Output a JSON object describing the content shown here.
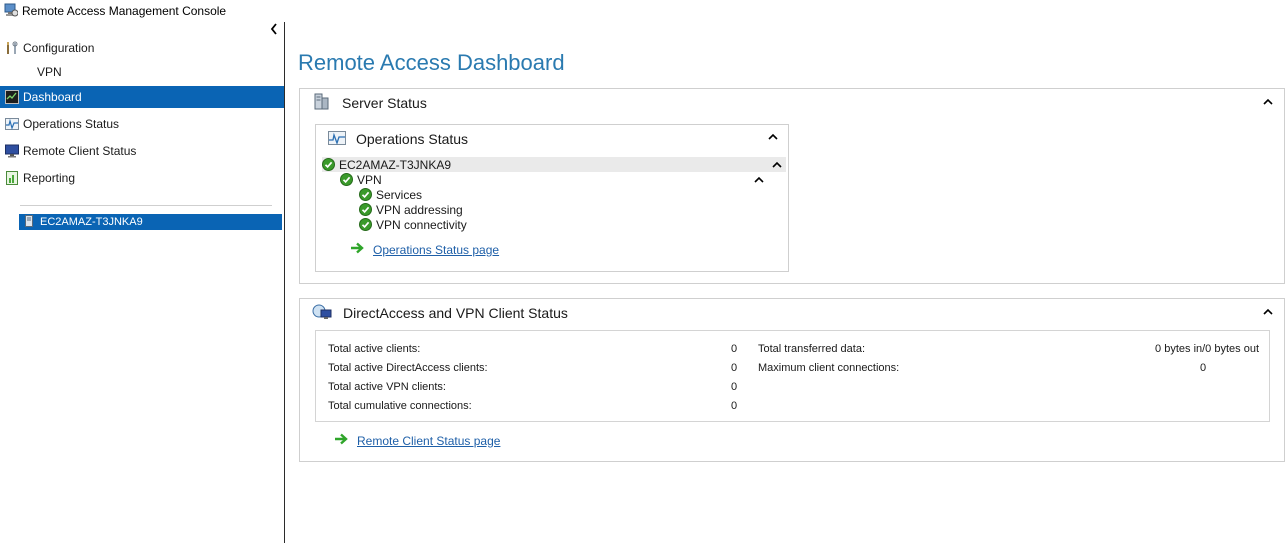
{
  "window": {
    "title": "Remote Access Management Console"
  },
  "nav": {
    "configuration": "Configuration",
    "vpn": "VPN",
    "dashboard": "Dashboard",
    "operations_status": "Operations Status",
    "remote_client_status": "Remote Client Status",
    "reporting": "Reporting",
    "server": "EC2AMAZ-T3JNKA9"
  },
  "main": {
    "title": "Remote Access Dashboard",
    "server_status": {
      "title": "Server Status",
      "operations": {
        "title": "Operations Status",
        "server": "EC2AMAZ-T3JNKA9",
        "vpn": "VPN",
        "services": "Services",
        "vpn_addressing": "VPN addressing",
        "vpn_connectivity": "VPN connectivity",
        "link": "Operations Status page"
      }
    },
    "client_status": {
      "title": "DirectAccess and VPN Client Status",
      "left_labels": [
        "Total active clients:",
        "Total active DirectAccess clients:",
        "Total active VPN clients:",
        "Total cumulative connections:"
      ],
      "left_values": [
        "0",
        "0",
        "0",
        "0"
      ],
      "right_labels": [
        "Total transferred data:",
        "Maximum client connections:"
      ],
      "right_values": [
        "0 bytes in/0 bytes out",
        "0"
      ],
      "link": "Remote Client Status page"
    }
  },
  "colors": {
    "accent": "#0a64b4",
    "title": "#2a7ab0",
    "link": "#1e5fa8",
    "ok": "#3a9a2a"
  }
}
